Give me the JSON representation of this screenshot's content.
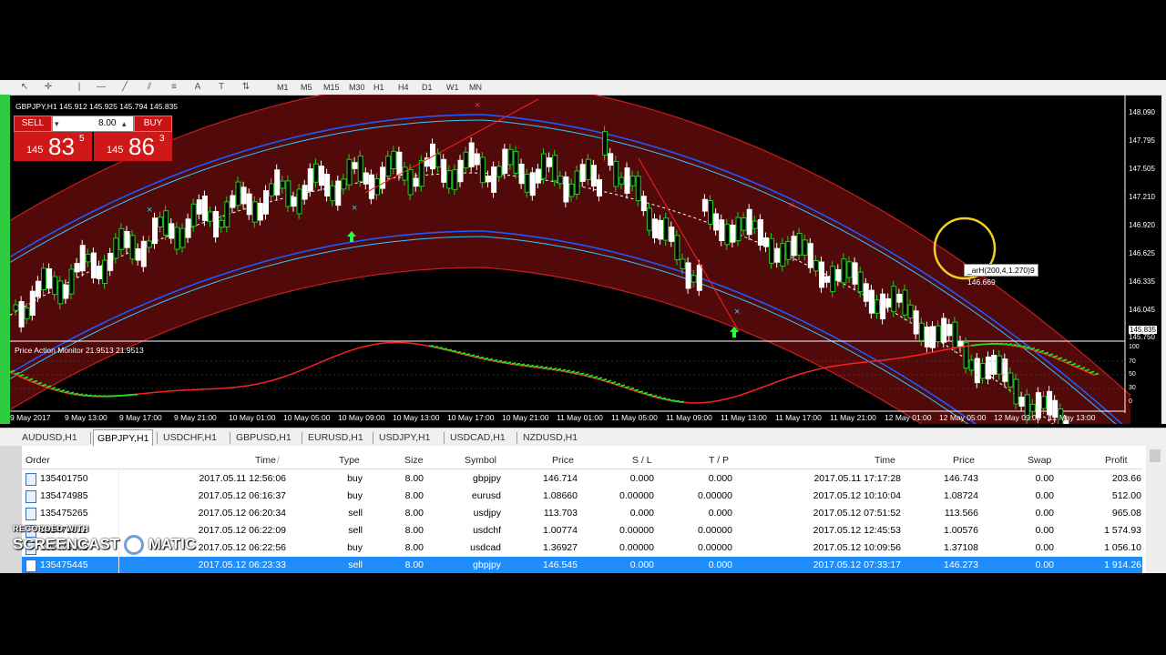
{
  "chart": {
    "symbol_info": "GBPJPY,H1  145.912 145.925 145.794 145.835",
    "oscillator_title": "Price Action Monitor 21.9513 21.9513",
    "price_scale": [
      "148.090",
      "147.795",
      "147.505",
      "147.210",
      "146.920",
      "146.625",
      "146.335",
      "146.045",
      "145.835",
      "145.750"
    ],
    "osc_scale": [
      "100",
      "70",
      "50",
      "30",
      "0"
    ],
    "time_labels": [
      "9 May 2017",
      "9 May 13:00",
      "9 May 17:00",
      "9 May 21:00",
      "10 May 01:00",
      "10 May 05:00",
      "10 May 09:00",
      "10 May 13:00",
      "10 May 17:00",
      "10 May 21:00",
      "11 May 01:00",
      "11 May 05:00",
      "11 May 09:00",
      "11 May 13:00",
      "11 May 17:00",
      "11 May 21:00",
      "12 May 01:00",
      "12 May 05:00",
      "12 May 09:00",
      "12 May 13:00"
    ],
    "crosshair_tooltip": "_arH(200,4,1.270)9",
    "crosshair_value": "146.669",
    "colors": {
      "band": "#5a0a0a",
      "band_edge": "#c81e1e",
      "blue_line": "#1e5aff",
      "cyan_line": "#32c8ff",
      "bull": "#ffffff",
      "bear": "#20d020"
    }
  },
  "trade_panel": {
    "sell_label": "SELL",
    "buy_label": "BUY",
    "lot_value": "8.00",
    "sell_big": "145",
    "sell_pips": "83",
    "sell_frac": "5",
    "buy_big": "145",
    "buy_pips": "86",
    "buy_frac": "3"
  },
  "toolbar": {
    "timeframes": [
      "M1",
      "M5",
      "M15",
      "M30",
      "H1",
      "H4",
      "D1",
      "W1",
      "MN"
    ]
  },
  "tabs": [
    "AUDUSD,H1",
    "GBPJPY,H1",
    "USDCHF,H1",
    "GBPUSD,H1",
    "EURUSD,H1",
    "USDJPY,H1",
    "USDCAD,H1",
    "NZDUSD,H1"
  ],
  "active_tab": "GBPJPY,H1",
  "table": {
    "headers": [
      "Order",
      "Time",
      "/",
      "Type",
      "Size",
      "Symbol",
      "Price",
      "S / L",
      "T / P",
      "Time",
      "Price",
      "Swap",
      "Profit"
    ],
    "rows": [
      {
        "order": "135401750",
        "time": "2017.05.11 12:56:06",
        "type": "buy",
        "size": "8.00",
        "symbol": "gbpjpy",
        "price": "146.714",
        "sl": "0.000",
        "tp": "0.000",
        "close_time": "2017.05.11 17:17:28",
        "close_price": "146.743",
        "swap": "0.00",
        "profit": "203.66"
      },
      {
        "order": "135474985",
        "time": "2017.05.12 06:16:37",
        "type": "buy",
        "size": "8.00",
        "symbol": "eurusd",
        "price": "1.08660",
        "sl": "0.00000",
        "tp": "0.00000",
        "close_time": "2017.05.12 10:10:04",
        "close_price": "1.08724",
        "swap": "0.00",
        "profit": "512.00"
      },
      {
        "order": "135475265",
        "time": "2017.05.12 06:20:34",
        "type": "sell",
        "size": "8.00",
        "symbol": "usdjpy",
        "price": "113.703",
        "sl": "0.000",
        "tp": "0.000",
        "close_time": "2017.05.12 07:51:52",
        "close_price": "113.566",
        "swap": "0.00",
        "profit": "965.08"
      },
      {
        "order": "135475311",
        "time": "2017.05.12 06:22:09",
        "type": "sell",
        "size": "8.00",
        "symbol": "usdchf",
        "price": "1.00774",
        "sl": "0.00000",
        "tp": "0.00000",
        "close_time": "2017.05.12 12:45:53",
        "close_price": "1.00576",
        "swap": "0.00",
        "profit": "1 574.93"
      },
      {
        "order": "135475362",
        "time": "2017.05.12 06:22:56",
        "type": "buy",
        "size": "8.00",
        "symbol": "usdcad",
        "price": "1.36927",
        "sl": "0.00000",
        "tp": "0.00000",
        "close_time": "2017.05.12 10:09:56",
        "close_price": "1.37108",
        "swap": "0.00",
        "profit": "1 056.10"
      },
      {
        "order": "135475445",
        "time": "2017.05.12 06:23:33",
        "type": "sell",
        "size": "8.00",
        "symbol": "gbpjpy",
        "price": "146.545",
        "sl": "0.000",
        "tp": "0.000",
        "close_time": "2017.05.12 07:33:17",
        "close_price": "146.273",
        "swap": "0.00",
        "profit": "1 914.26"
      }
    ]
  },
  "watermark": {
    "line1": "RECORDED WITH",
    "line2": "SCREENCAST",
    "line3": "MATIC"
  }
}
